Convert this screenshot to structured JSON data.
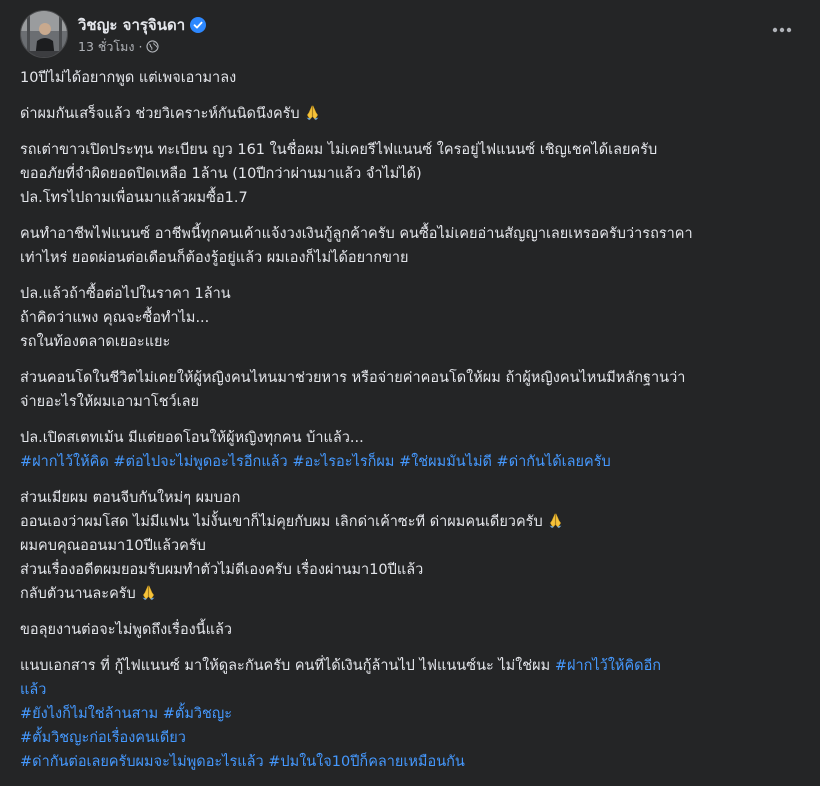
{
  "post": {
    "author": "วิชญะ จารุจินดา",
    "time": "13 ชั่วโมง",
    "separator": "·",
    "paragraphs": [
      {
        "lines": [
          [
            "10ปีไม่ได้อยากพูด แต่เพจเอามาลง"
          ]
        ]
      },
      {
        "lines": [
          [
            "ด่าผมกันเสร็จแล้ว ช่วยวิเคราะห์กันนิดนึงครับ",
            {
              "emoji": "pray"
            }
          ]
        ]
      },
      {
        "lines": [
          [
            "รถเต่าขาวเปิดประทุน ทะเบียน ญว 161 ในชื่อผม ไม่เคยรีไฟแนนซ์ ใครอยู่ไฟแนนซ์ เชิญเชคได้เลยครับ"
          ],
          [
            "ขออภัยที่จำผิดยอดปิดเหลือ 1ล้าน (10ปีกว่าผ่านมาแล้ว จำไม่ได้)"
          ],
          [
            "ปล.โทรไปถามเพื่อนมาแล้วผมซื้อ1.7"
          ]
        ]
      },
      {
        "lines": [
          [
            "คนทำอาชีพไฟแนนซ์ อาชีพนี้ทุกคนเค้าแจ้งวงเงินกู้ลูกค้าครับ คนซื้อไม่เคยอ่านสัญญาเลยเหรอครับว่ารถราคา"
          ],
          [
            "เท่าไหร่ ยอดผ่อนต่อเดือนก็ต้องรู้อยู่แล้ว ผมเองก็ไม่ได้อยากขาย"
          ]
        ]
      },
      {
        "lines": [
          [
            "ปล.แล้วถ้าซื้อต่อไปในราคา 1ล้าน"
          ],
          [
            "ถ้าคิดว่าแพง คุณจะซื้อทำไม..."
          ],
          [
            "รถในท้องตลาดเยอะแยะ"
          ]
        ]
      },
      {
        "lines": [
          [
            "ส่วนคอนโดในชีวิตไม่เคยให้ผู้หญิงคนไหนมาช่วยหาร หรือจ่ายค่าคอนโดให้ผม ถ้าผู้หญิงคนไหนมีหลักฐานว่า"
          ],
          [
            "จ่ายอะไรให้ผมเอามาโชว์เลย"
          ]
        ]
      },
      {
        "lines": [
          [
            "ปล.เปิดสเตทเม้น มีแต่ยอดโอนให้ผู้หญิงทุกคน บ้าแล้ว..."
          ],
          [
            {
              "tag": "#ฝากไว้ให้คิด"
            },
            " ",
            {
              "tag": "#ต่อไปจะไม่พูดอะไรอีกแล้ว"
            },
            " ",
            {
              "tag": "#อะไรอะไรก็ผม"
            },
            " ",
            {
              "tag": "#ใช่ผมมันไม่ดี"
            },
            " ",
            {
              "tag": "#ด่ากันได้เลยครับ"
            }
          ]
        ]
      },
      {
        "lines": [
          [
            "ส่วนเมียผม ตอนจีบกันใหม่ๆ ผมบอก"
          ],
          [
            "ออนเองว่าผมโสด ไม่มีแฟน ไม่งั้นเขาก็ไม่คุยกับผม เลิกด่าเค้าซะที ด่าผมคนเดียวครับ",
            {
              "emoji": "pray"
            }
          ],
          [
            "ผมคบคุณออนมา10ปีแล้วครับ"
          ],
          [
            "ส่วนเรื่องอดีตผมยอมรับผมทำตัวไม่ดีเองครับ เรื่องผ่านมา10ปีแล้ว"
          ],
          [
            "กลับตัวนานละครับ",
            {
              "emoji": "pray"
            }
          ]
        ]
      },
      {
        "lines": [
          [
            "ขอลุยงานต่อจะไม่พูดถึงเรื่องนี้แล้ว"
          ]
        ]
      },
      {
        "lines": [
          [
            "แนบเอกสาร ที่ กู้ไฟแนนซ์ มาให้ดูละกันครับ คนที่ได้เงินกู้ล้านไป ไฟแนนซ์นะ ไม่ใช่ผม ",
            {
              "tag": "#ฝากไว้ให้คิดอีก"
            }
          ],
          [
            {
              "tag": "แล้ว"
            }
          ],
          [
            {
              "tag": "#ยังไงก็ไม่ใช่ล้านสาม"
            },
            " ",
            {
              "tag": "#ตั้มวิชญะ"
            }
          ],
          [
            {
              "tag": "#ตั้มวิชญะก่อเรื่องคนเดียว"
            }
          ],
          [
            {
              "tag": "#ด่ากันต่อเลยครับผมจะไม่พูดอะไรแล้ว"
            },
            " ",
            {
              "tag": "#ปมในใจ10ปีก็คลายเหมือนกัน"
            }
          ]
        ]
      }
    ]
  },
  "icons": {
    "verified": "verified-badge-icon",
    "globe": "public-globe-icon",
    "more": "more-options-icon",
    "pray": "folded-hands-emoji"
  },
  "colors": {
    "background": "#242526",
    "text": "#e4e6eb",
    "secondary": "#b0b3b8",
    "hashtag": "#4599ff",
    "verified": "#2d88ff"
  }
}
